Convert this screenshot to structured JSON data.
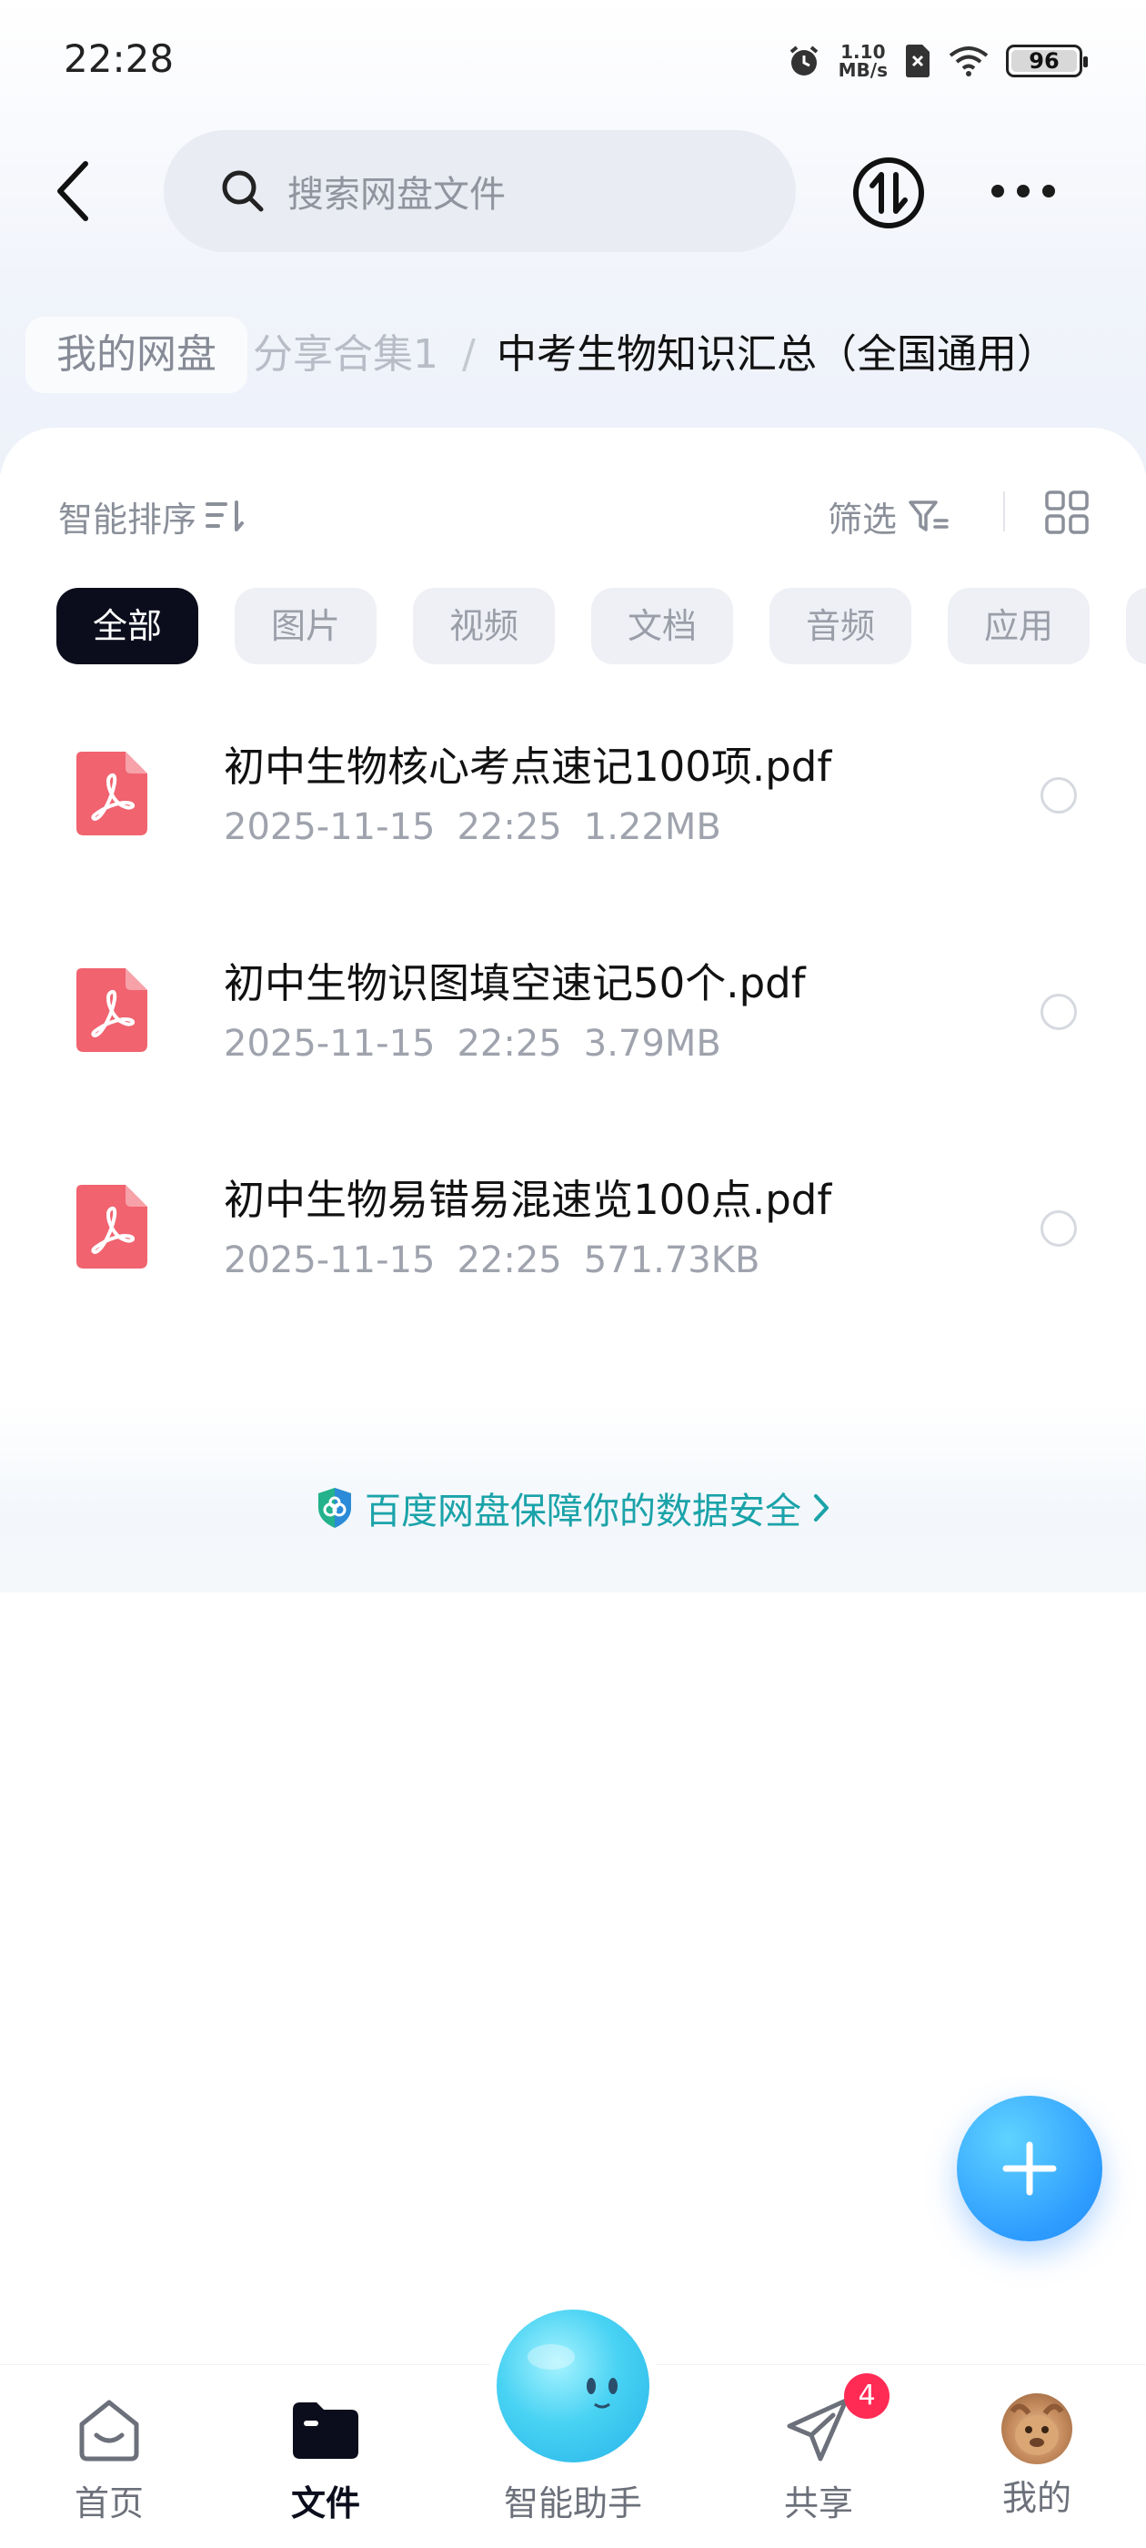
{
  "status_bar": {
    "time": "22:28",
    "speed_value": "1.10",
    "speed_unit": "MB/s",
    "battery": "96",
    "icons": [
      "alarm-icon",
      "no-sim-icon",
      "wifi-icon",
      "battery-icon"
    ]
  },
  "header": {
    "search_placeholder": "搜索网盘文件",
    "icons": [
      "back-arrow-icon",
      "search-icon",
      "transfer-icon",
      "more-icon"
    ]
  },
  "breadcrumb": {
    "home": "我的网盘",
    "middle": "分享合集1",
    "separator": "/",
    "current": "中考生物知识汇总（全国通用）"
  },
  "toolbar": {
    "sort_label": "智能排序",
    "filter_label": "筛选"
  },
  "chips": [
    {
      "label": "全部",
      "active": true
    },
    {
      "label": "图片",
      "active": false
    },
    {
      "label": "视频",
      "active": false
    },
    {
      "label": "文档",
      "active": false
    },
    {
      "label": "音频",
      "active": false
    },
    {
      "label": "应用",
      "active": false
    }
  ],
  "files": [
    {
      "name": "初中生物核心考点速记100项.pdf",
      "date": "2025-11-15",
      "time": "22:25",
      "size": "1.22MB",
      "icon": "pdf-icon"
    },
    {
      "name": "初中生物识图填空速记50个.pdf",
      "date": "2025-11-15",
      "time": "22:25",
      "size": "3.79MB",
      "icon": "pdf-icon"
    },
    {
      "name": "初中生物易错易混速览100点.pdf",
      "date": "2025-11-15",
      "time": "22:25",
      "size": "571.73KB",
      "icon": "pdf-icon"
    }
  ],
  "security": {
    "text": "百度网盘保障你的数据安全",
    "color": "#1aa3a9"
  },
  "bottom_nav": {
    "home": "首页",
    "files": "文件",
    "assistant": "智能助手",
    "share": "共享",
    "share_badge": "4",
    "mine": "我的"
  },
  "colors": {
    "accent_dark": "#0b0d1c",
    "pdf_red": "#f0636f",
    "fab_blue": "#2d9cff",
    "badge_red": "#ff2b55"
  }
}
